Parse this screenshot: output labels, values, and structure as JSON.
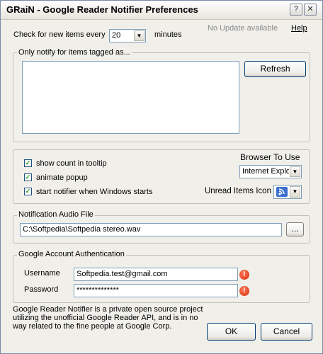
{
  "window": {
    "title": "GRaiN - Google Reader Notifier Preferences"
  },
  "check": {
    "label": "Check for new items every",
    "interval": "20",
    "unit": "minutes"
  },
  "update_status": "No Update available",
  "help_link": "Help",
  "tags": {
    "legend": "Only notify for items tagged as...",
    "refresh_label": "Refresh"
  },
  "options": {
    "show_count": "show count in tooltip",
    "animate": "animate popup",
    "start_notifier": "start notifier when Windows starts",
    "check_mark": "✓"
  },
  "browser": {
    "label": "Browser To Use",
    "value": "Internet Explo"
  },
  "unread_icon": {
    "label": "Unread Items Icon"
  },
  "audio": {
    "legend": "Notification Audio File",
    "path": "C:\\Softpedia\\Softpedia stereo.wav",
    "browse_label": "..."
  },
  "account": {
    "legend": "Google Account Authentication",
    "username_label": "Username",
    "username": "Softpedia.test@gmail.com",
    "password_label": "Password",
    "password": "**************"
  },
  "footer_text": "Google Reader Notifier is a private open source project utilizing the unofficial Google Reader API, and is in no way related to the fine people at Google Corp.",
  "ok_label": "OK",
  "cancel_label": "Cancel",
  "glyphs": {
    "help": "?",
    "close": "✕",
    "dropdown": "▼",
    "error": "!"
  }
}
